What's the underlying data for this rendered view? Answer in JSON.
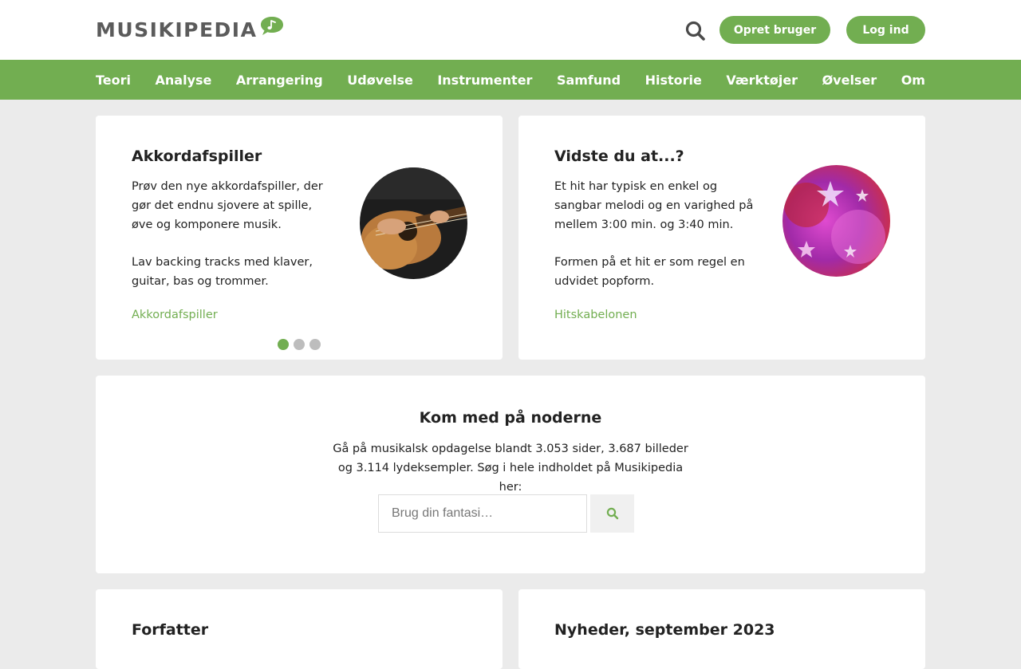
{
  "header": {
    "logo_text": "MUSIKIPEDIA",
    "logo_icon": "music-note-speech-bubble",
    "search_icon": "search-icon",
    "signup_label": "Opret bruger",
    "login_label": "Log ind"
  },
  "nav": {
    "items": [
      "Teori",
      "Analyse",
      "Arrangering",
      "Udøvelse",
      "Instrumenter",
      "Samfund",
      "Historie",
      "Værktøjer",
      "Øvelser",
      "Om"
    ]
  },
  "carousel": {
    "title": "Akkordafspiller",
    "paragraph1": "Prøv den nye akkordafspiller, der gør det endnu sjovere at spille, øve og komponere musik.",
    "paragraph2": "Lav backing tracks med klaver, guitar, bas og trommer.",
    "link": "Akkordafspiller",
    "image": "acoustic-guitar-photo",
    "dots": 3,
    "active_dot": 1
  },
  "fact": {
    "title": "Vidste du at...?",
    "paragraph1": "Et hit har typisk en enkel og sangbar melodi og en varighed på mellem 3:00 min. og 3:40 min.",
    "paragraph2": "Formen på et hit er som regel en udvidet popform.",
    "link": "Hitskabelonen",
    "image": "stars-abstract-photo"
  },
  "search": {
    "title": "Kom med på noderne",
    "text": "Gå på musikalsk opdagelse blandt 3.053 sider, 3.687 billeder og 3.114 lydeksempler. Søg i hele indholdet på Musikipedia her:",
    "placeholder": "Brug din fantasi…",
    "button_icon": "search-icon"
  },
  "bottom": {
    "left_title": "Forfatter",
    "right_title": "Nyheder, september 2023"
  },
  "colors": {
    "brand_green": "#72ae51",
    "background": "#ebebeb",
    "text": "#222222"
  }
}
